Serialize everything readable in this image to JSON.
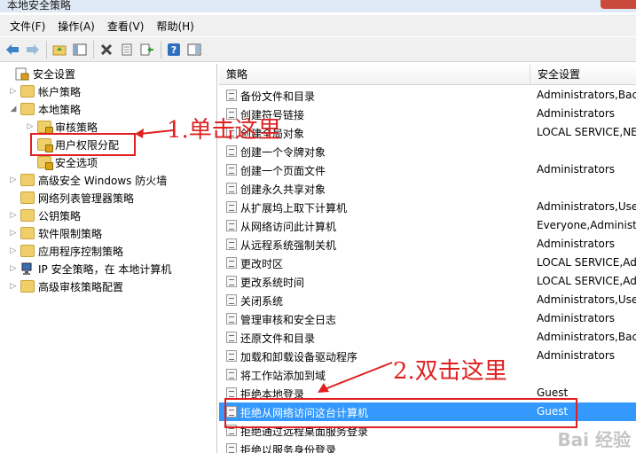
{
  "window": {
    "title": "本地安全策略"
  },
  "menu": [
    "文件(F)",
    "操作(A)",
    "查看(V)",
    "帮助(H)"
  ],
  "toolbar": [
    "back-icon",
    "forward-icon",
    "up-folder-icon",
    "show-tree-icon",
    "delete-icon",
    "properties-icon",
    "export-icon",
    "help-icon",
    "view-icon"
  ],
  "tree": [
    {
      "label": "安全设置",
      "level": 0,
      "expanded": true
    },
    {
      "label": "帐户策略",
      "level": 1,
      "expanded": false
    },
    {
      "label": "本地策略",
      "level": 1,
      "expanded": true
    },
    {
      "label": "审核策略",
      "level": 2,
      "expanded": false
    },
    {
      "label": "用户权限分配",
      "level": 2,
      "selected": true
    },
    {
      "label": "安全选项",
      "level": 2
    },
    {
      "label": "高级安全 Windows 防火墙",
      "level": 1,
      "expanded": false
    },
    {
      "label": "网络列表管理器策略",
      "level": 1
    },
    {
      "label": "公钥策略",
      "level": 1,
      "expanded": false
    },
    {
      "label": "软件限制策略",
      "level": 1,
      "expanded": false
    },
    {
      "label": "应用程序控制策略",
      "level": 1,
      "expanded": false
    },
    {
      "label": "IP 安全策略，在 本地计算机",
      "level": 1,
      "expanded": false
    },
    {
      "label": "高级审核策略配置",
      "level": 1,
      "expanded": false
    }
  ],
  "columns": {
    "policy": "策略",
    "setting": "安全设置"
  },
  "policies": [
    {
      "name": "备份文件和目录",
      "setting": "Administrators,Backup"
    },
    {
      "name": "创建符号链接",
      "setting": "Administrators"
    },
    {
      "name": "创建全局对象",
      "setting": "LOCAL SERVICE,NET"
    },
    {
      "name": "创建一个令牌对象",
      "setting": ""
    },
    {
      "name": "创建一个页面文件",
      "setting": "Administrators"
    },
    {
      "name": "创建永久共享对象",
      "setting": ""
    },
    {
      "name": "从扩展坞上取下计算机",
      "setting": "Administrators,Users"
    },
    {
      "name": "从网络访问此计算机",
      "setting": "Everyone,Administrators"
    },
    {
      "name": "从远程系统强制关机",
      "setting": "Administrators"
    },
    {
      "name": "更改时区",
      "setting": "LOCAL SERVICE,Adm"
    },
    {
      "name": "更改系统时间",
      "setting": "LOCAL SERVICE,Adm"
    },
    {
      "name": "关闭系统",
      "setting": "Administrators,Users"
    },
    {
      "name": "管理审核和安全日志",
      "setting": "Administrators"
    },
    {
      "name": "还原文件和目录",
      "setting": "Administrators,Backup"
    },
    {
      "name": "加载和卸载设备驱动程序",
      "setting": "Administrators"
    },
    {
      "name": "将工作站添加到域",
      "setting": ""
    },
    {
      "name": "拒绝本地登录",
      "setting": "Guest"
    },
    {
      "name": "拒绝从网络访问这台计算机",
      "setting": "Guest",
      "selected": true
    },
    {
      "name": "拒绝通过远程桌面服务登录",
      "setting": ""
    },
    {
      "name": "拒绝以服务身份登录",
      "setting": ""
    }
  ],
  "annotations": {
    "step1": "1.单击这里",
    "step2": "2.双击这里"
  },
  "watermark": "Bai 经验",
  "colors": {
    "annotation": "#e02020",
    "selection": "#3399ff"
  }
}
